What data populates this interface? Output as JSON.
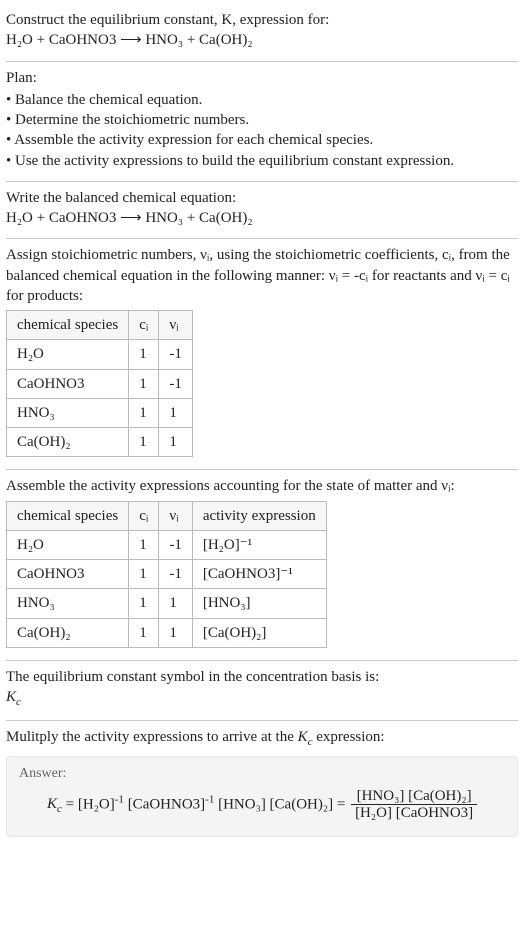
{
  "intro": {
    "line1": "Construct the equilibrium constant, K, expression for:",
    "equation": "H₂O + CaOHNO3 ⟶ HNO₃ + Ca(OH)₂"
  },
  "plan": {
    "title": "Plan:",
    "items": [
      "Balance the chemical equation.",
      "Determine the stoichiometric numbers.",
      "Assemble the activity expression for each chemical species.",
      "Use the activity expressions to build the equilibrium constant expression."
    ]
  },
  "balanced": {
    "title": "Write the balanced chemical equation:",
    "equation": "H₂O + CaOHNO3 ⟶ HNO₃ + Ca(OH)₂"
  },
  "stoich": {
    "intro": "Assign stoichiometric numbers, νᵢ, using the stoichiometric coefficients, cᵢ, from the balanced chemical equation in the following manner: νᵢ = -cᵢ for reactants and νᵢ = cᵢ for products:",
    "headers": [
      "chemical species",
      "cᵢ",
      "νᵢ"
    ],
    "rows": [
      [
        "H₂O",
        "1",
        "-1"
      ],
      [
        "CaOHNO3",
        "1",
        "-1"
      ],
      [
        "HNO₃",
        "1",
        "1"
      ],
      [
        "Ca(OH)₂",
        "1",
        "1"
      ]
    ]
  },
  "activity": {
    "intro": "Assemble the activity expressions accounting for the state of matter and νᵢ:",
    "headers": [
      "chemical species",
      "cᵢ",
      "νᵢ",
      "activity expression"
    ],
    "rows": [
      [
        "H₂O",
        "1",
        "-1",
        "[H₂O]⁻¹"
      ],
      [
        "CaOHNO3",
        "1",
        "-1",
        "[CaOHNO3]⁻¹"
      ],
      [
        "HNO₃",
        "1",
        "1",
        "[HNO₃]"
      ],
      [
        "Ca(OH)₂",
        "1",
        "1",
        "[Ca(OH)₂]"
      ]
    ]
  },
  "symbol": {
    "line": "The equilibrium constant symbol in the concentration basis is:",
    "sym": "K_c"
  },
  "multiply": {
    "line": "Mulitply the activity expressions to arrive at the K_c expression:"
  },
  "answer": {
    "label": "Answer:",
    "lhs": "K_c = [H₂O]⁻¹ [CaOHNO3]⁻¹ [HNO₃] [Ca(OH)₂] = ",
    "frac_num": "[HNO₃] [Ca(OH)₂]",
    "frac_den": "[H₂O] [CaOHNO3]"
  },
  "chart_data": {
    "type": "table",
    "tables": [
      {
        "title": "stoichiometric numbers",
        "columns": [
          "chemical species",
          "c_i",
          "nu_i"
        ],
        "rows": [
          {
            "chemical species": "H2O",
            "c_i": 1,
            "nu_i": -1
          },
          {
            "chemical species": "CaOHNO3",
            "c_i": 1,
            "nu_i": -1
          },
          {
            "chemical species": "HNO3",
            "c_i": 1,
            "nu_i": 1
          },
          {
            "chemical species": "Ca(OH)2",
            "c_i": 1,
            "nu_i": 1
          }
        ]
      },
      {
        "title": "activity expressions",
        "columns": [
          "chemical species",
          "c_i",
          "nu_i",
          "activity expression"
        ],
        "rows": [
          {
            "chemical species": "H2O",
            "c_i": 1,
            "nu_i": -1,
            "activity expression": "[H2O]^-1"
          },
          {
            "chemical species": "CaOHNO3",
            "c_i": 1,
            "nu_i": -1,
            "activity expression": "[CaOHNO3]^-1"
          },
          {
            "chemical species": "HNO3",
            "c_i": 1,
            "nu_i": 1,
            "activity expression": "[HNO3]"
          },
          {
            "chemical species": "Ca(OH)2",
            "c_i": 1,
            "nu_i": 1,
            "activity expression": "[Ca(OH)2]"
          }
        ]
      }
    ]
  }
}
